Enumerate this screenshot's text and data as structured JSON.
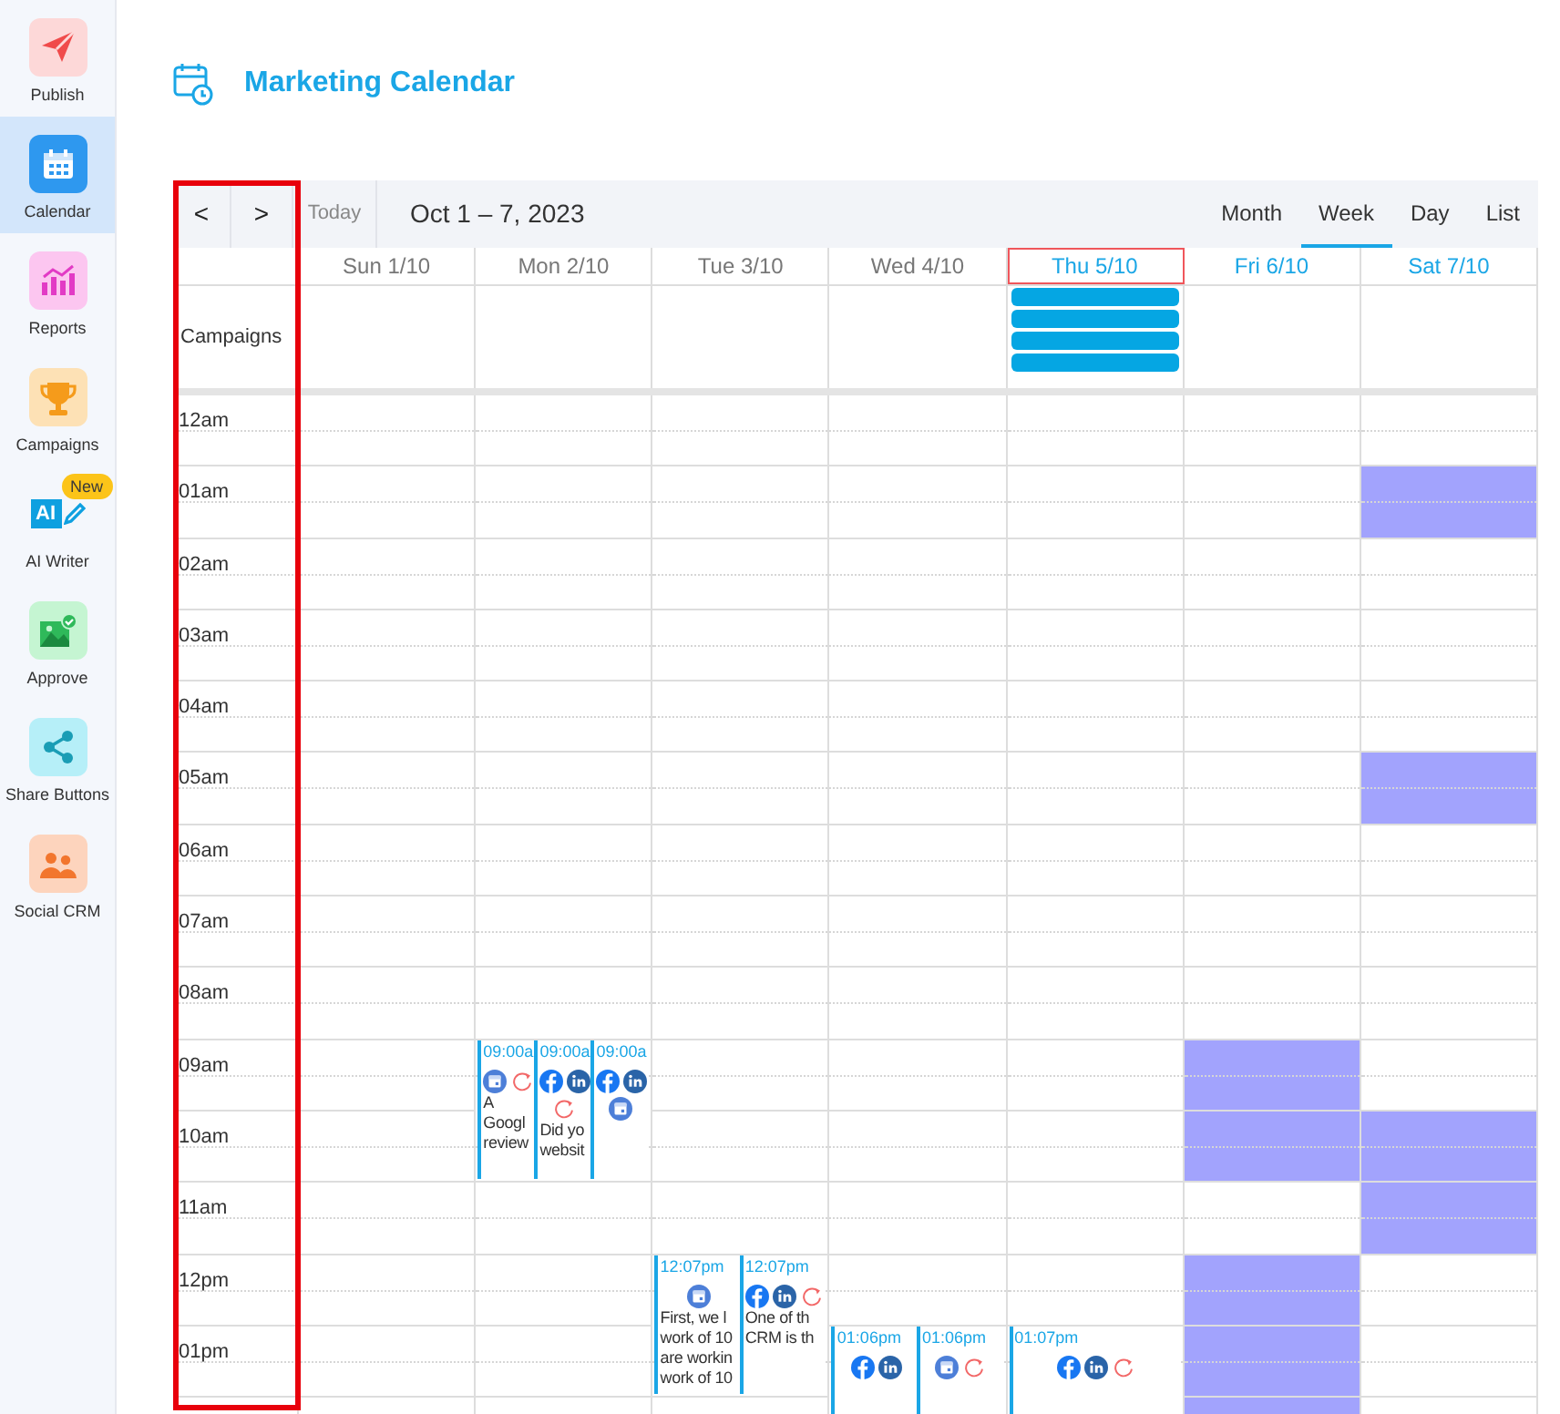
{
  "sidebar": {
    "items": [
      {
        "label": "Publish",
        "kind": "publish",
        "selected": false
      },
      {
        "label": "Calendar",
        "kind": "calendar",
        "selected": true
      },
      {
        "label": "Reports",
        "kind": "reports",
        "selected": false
      },
      {
        "label": "Campaigns",
        "kind": "campaigns",
        "selected": false
      },
      {
        "label": "AI Writer",
        "kind": "ai",
        "icon_text": "AI",
        "badge": "New",
        "selected": false
      },
      {
        "label": "Approve",
        "kind": "approve",
        "selected": false
      },
      {
        "label": "Share Buttons",
        "kind": "share",
        "selected": false
      },
      {
        "label": "Social CRM",
        "kind": "crm",
        "selected": false
      }
    ]
  },
  "page": {
    "title": "Marketing Calendar"
  },
  "calendar": {
    "annotation": {
      "kind": "outline"
    },
    "toolbar": {
      "prev": "<",
      "next": ">",
      "today": "Today",
      "range": "Oct 1 – 7, 2023",
      "views": [
        {
          "label": "Month",
          "selected": false
        },
        {
          "label": "Week",
          "selected": true
        },
        {
          "label": "Day",
          "selected": false
        },
        {
          "label": "List",
          "selected": false
        }
      ]
    },
    "campaigns_label": "Campaigns",
    "days": [
      {
        "label": "Sun 1/10",
        "kind": "past"
      },
      {
        "label": "Mon 2/10",
        "kind": "past"
      },
      {
        "label": "Tue 3/10",
        "kind": "past"
      },
      {
        "label": "Wed 4/10",
        "kind": "past"
      },
      {
        "label": "Thu 5/10",
        "kind": "today",
        "campaigns": [
          {
            "kind": "bar"
          },
          {
            "kind": "bar"
          },
          {
            "kind": "bar"
          },
          {
            "kind": "bar"
          }
        ]
      },
      {
        "label": "Fri 6/10",
        "kind": "future"
      },
      {
        "label": "Sat 7/10",
        "kind": "future"
      }
    ],
    "hours": [
      {
        "label": "12am",
        "cells": [
          {
            "shaded": false
          },
          {
            "shaded": false
          },
          {
            "shaded": false
          },
          {
            "shaded": false
          },
          {
            "shaded": false
          },
          {
            "shaded": false
          },
          {
            "shaded": false
          }
        ]
      },
      {
        "label": "01am",
        "cells": [
          {
            "shaded": false
          },
          {
            "shaded": false
          },
          {
            "shaded": false
          },
          {
            "shaded": false
          },
          {
            "shaded": false
          },
          {
            "shaded": false
          },
          {
            "shaded": true
          }
        ]
      },
      {
        "label": "02am",
        "cells": [
          {
            "shaded": false
          },
          {
            "shaded": false
          },
          {
            "shaded": false
          },
          {
            "shaded": false
          },
          {
            "shaded": false
          },
          {
            "shaded": false
          },
          {
            "shaded": false
          }
        ]
      },
      {
        "label": "03am",
        "cells": [
          {
            "shaded": false
          },
          {
            "shaded": false
          },
          {
            "shaded": false
          },
          {
            "shaded": false
          },
          {
            "shaded": false
          },
          {
            "shaded": false
          },
          {
            "shaded": false
          }
        ]
      },
      {
        "label": "04am",
        "cells": [
          {
            "shaded": false
          },
          {
            "shaded": false
          },
          {
            "shaded": false
          },
          {
            "shaded": false
          },
          {
            "shaded": false
          },
          {
            "shaded": false
          },
          {
            "shaded": false
          }
        ]
      },
      {
        "label": "05am",
        "cells": [
          {
            "shaded": false
          },
          {
            "shaded": false
          },
          {
            "shaded": false
          },
          {
            "shaded": false
          },
          {
            "shaded": false
          },
          {
            "shaded": false
          },
          {
            "shaded": true
          }
        ]
      },
      {
        "label": "06am",
        "cells": [
          {
            "shaded": false
          },
          {
            "shaded": false
          },
          {
            "shaded": false
          },
          {
            "shaded": false
          },
          {
            "shaded": false
          },
          {
            "shaded": false
          },
          {
            "shaded": false
          }
        ]
      },
      {
        "label": "07am",
        "cells": [
          {
            "shaded": false
          },
          {
            "shaded": false
          },
          {
            "shaded": false
          },
          {
            "shaded": false
          },
          {
            "shaded": false
          },
          {
            "shaded": false
          },
          {
            "shaded": false
          }
        ]
      },
      {
        "label": "08am",
        "cells": [
          {
            "shaded": false
          },
          {
            "shaded": false
          },
          {
            "shaded": false
          },
          {
            "shaded": false
          },
          {
            "shaded": false
          },
          {
            "shaded": false
          },
          {
            "shaded": false
          }
        ]
      },
      {
        "label": "09am",
        "cells": [
          {
            "shaded": false
          },
          {
            "shaded": false,
            "events": [
              {
                "time": "09:00a",
                "icons": [
                  {
                    "kind": "gmb"
                  },
                  {
                    "kind": "repeat"
                  }
                ],
                "lines": [
                  "A",
                  "Googl",
                  "review"
                ]
              },
              {
                "time": "09:00a",
                "icons": [
                  {
                    "kind": "facebook"
                  },
                  {
                    "kind": "linkedin"
                  },
                  {
                    "kind": "repeat"
                  }
                ],
                "lines": [
                  "Did yo",
                  "websit"
                ]
              },
              {
                "time": "09:00a",
                "icons": [
                  {
                    "kind": "facebook"
                  },
                  {
                    "kind": "linkedin"
                  },
                  {
                    "kind": "gmb"
                  }
                ]
              }
            ]
          },
          {
            "shaded": false
          },
          {
            "shaded": false
          },
          {
            "shaded": false
          },
          {
            "shaded": true
          },
          {
            "shaded": false
          }
        ]
      },
      {
        "label": "10am",
        "cells": [
          {
            "shaded": false
          },
          {
            "shaded": false
          },
          {
            "shaded": false
          },
          {
            "shaded": false
          },
          {
            "shaded": false
          },
          {
            "shaded": true
          },
          {
            "shaded": true
          }
        ]
      },
      {
        "label": "11am",
        "cells": [
          {
            "shaded": false
          },
          {
            "shaded": false
          },
          {
            "shaded": false
          },
          {
            "shaded": false
          },
          {
            "shaded": false
          },
          {
            "shaded": false
          },
          {
            "shaded": true
          }
        ]
      },
      {
        "label": "12pm",
        "cells": [
          {
            "shaded": false
          },
          {
            "shaded": false
          },
          {
            "shaded": false,
            "events": [
              {
                "time": "12:07pm",
                "icons": [
                  {
                    "kind": "gmb"
                  }
                ],
                "lines": [
                  "First, we l",
                  "work of 10",
                  "are workin",
                  "work of 10"
                ]
              },
              {
                "time": "12:07pm",
                "icons": [
                  {
                    "kind": "facebook"
                  },
                  {
                    "kind": "linkedin"
                  },
                  {
                    "kind": "repeat"
                  }
                ],
                "lines": [
                  "One of th",
                  "CRM is th"
                ]
              }
            ]
          },
          {
            "shaded": false
          },
          {
            "shaded": false
          },
          {
            "shaded": true
          },
          {
            "shaded": false
          }
        ]
      },
      {
        "label": "01pm",
        "cells": [
          {
            "shaded": false
          },
          {
            "shaded": false
          },
          {
            "shaded": false
          },
          {
            "shaded": false,
            "events": [
              {
                "time": "01:06pm",
                "icons": [
                  {
                    "kind": "facebook"
                  },
                  {
                    "kind": "linkedin"
                  }
                ]
              },
              {
                "time": "01:06pm",
                "icons": [
                  {
                    "kind": "gmb"
                  },
                  {
                    "kind": "repeat"
                  }
                ]
              }
            ]
          },
          {
            "shaded": false,
            "events": [
              {
                "time": "01:07pm",
                "icons": [
                  {
                    "kind": "facebook"
                  },
                  {
                    "kind": "linkedin"
                  },
                  {
                    "kind": "repeat"
                  }
                ]
              }
            ]
          },
          {
            "shaded": true
          },
          {
            "shaded": false
          }
        ]
      },
      {
        "cells": [
          {
            "shaded": false
          },
          {
            "shaded": false
          },
          {
            "shaded": false
          },
          {
            "shaded": false
          },
          {
            "shaded": false
          },
          {
            "shaded": true
          },
          {
            "shaded": false
          }
        ]
      }
    ]
  }
}
